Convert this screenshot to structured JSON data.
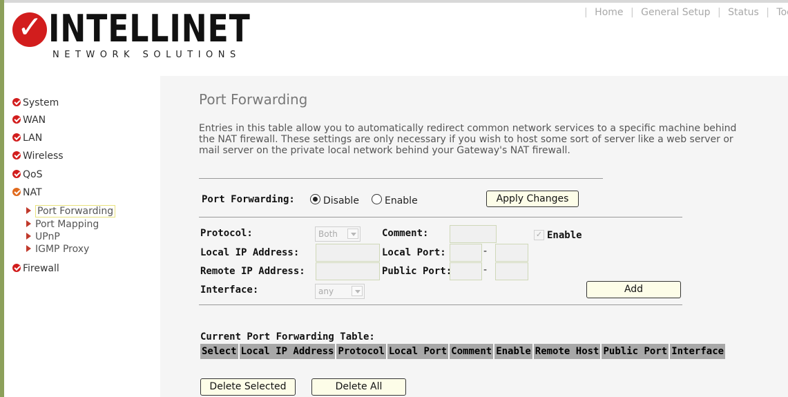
{
  "brand": {
    "name": "INTELLINET",
    "tagline": "NETWORK SOLUTIONS"
  },
  "topnav": [
    "Home",
    "General Setup",
    "Status",
    "Tool"
  ],
  "sidebar": {
    "items": [
      "System",
      "WAN",
      "LAN",
      "Wireless",
      "QoS",
      "NAT",
      "Firewall"
    ],
    "nat_subitems": [
      "Port Forwarding",
      "Port Mapping",
      "UPnP",
      "IGMP Proxy"
    ],
    "active_subitem": "Port Forwarding"
  },
  "page": {
    "title": "Port Forwarding",
    "description": "Entries in this table allow you to automatically redirect common network services to a specific machine behind the NAT firewall. These settings are only necessary if you wish to host some sort of server like a web server or mail server on the private local network behind your Gateway's NAT firewall."
  },
  "port_forwarding": {
    "label": "Port Forwarding:",
    "options": [
      "Disable",
      "Enable"
    ],
    "selected": "Disable",
    "apply_label": "Apply Changes"
  },
  "form": {
    "protocol_label": "Protocol:",
    "protocol_value": "Both",
    "comment_label": "Comment:",
    "enable_label": "Enable",
    "local_ip_label": "Local IP Address:",
    "local_port_label": "Local Port:",
    "remote_ip_label": "Remote IP Address:",
    "public_port_label": "Public Port:",
    "interface_label": "Interface:",
    "interface_value": "any",
    "add_label": "Add",
    "range_sep": "-"
  },
  "table": {
    "title": "Current Port Forwarding Table:",
    "headers": [
      "Select",
      "Local IP Address",
      "Protocol",
      "Local Port",
      "Comment",
      "Enable",
      "Remote Host",
      "Public Port",
      "Interface"
    ]
  },
  "actions": {
    "delete_selected": "Delete Selected",
    "delete_all": "Delete All"
  }
}
